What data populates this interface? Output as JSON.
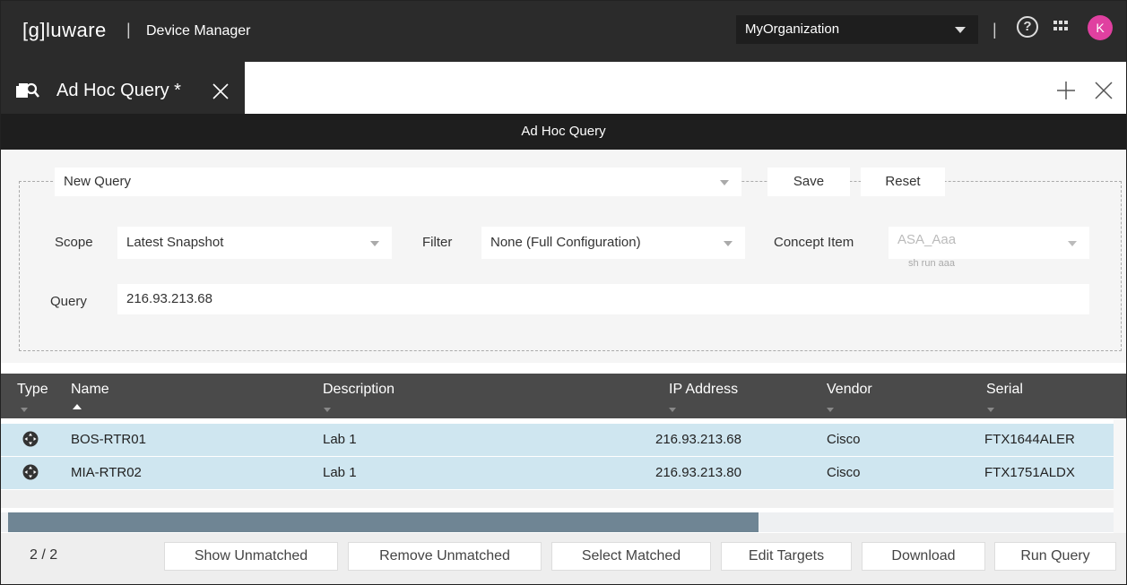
{
  "topbar": {
    "logo_bracket": "[g]",
    "logo_text": "luware",
    "separator": "|",
    "app_title": "Device Manager",
    "organization": "MyOrganization",
    "separator2": "|",
    "avatar_initial": "K",
    "avatar_color": "#e040a0"
  },
  "tabs": {
    "active_label": "Ad Hoc Query *"
  },
  "header": {
    "title": "Ad Hoc Query"
  },
  "query": {
    "saved_query": "New Query",
    "save_label": "Save",
    "reset_label": "Reset",
    "scope_label": "Scope",
    "scope_value": "Latest Snapshot",
    "filter_label": "Filter",
    "filter_value": "None (Full Configuration)",
    "concept_label": "Concept Item",
    "concept_value": "ASA_Aaa",
    "concept_sub": "sh run aaa",
    "query_label": "Query",
    "query_value": "216.93.213.68"
  },
  "grid": {
    "columns": [
      "Type",
      "Name",
      "Description",
      "IP Address",
      "Vendor",
      "Serial"
    ],
    "rows": [
      {
        "name": "BOS-RTR01",
        "description": "Lab 1",
        "ip": "216.93.213.68",
        "vendor": "Cisco",
        "serial": "FTX1644ALER"
      },
      {
        "name": "MIA-RTR02",
        "description": "Lab 1",
        "ip": "216.93.213.80",
        "vendor": "Cisco",
        "serial": "FTX1751ALDX"
      }
    ],
    "row_highlight": "#cfe6f0",
    "header_bg": "#4a4a4a"
  },
  "footer": {
    "count": "2 / 2",
    "buttons": [
      "Show Unmatched",
      "Remove Unmatched",
      "Select Matched",
      "Edit Targets",
      "Download",
      "Run Query"
    ]
  }
}
